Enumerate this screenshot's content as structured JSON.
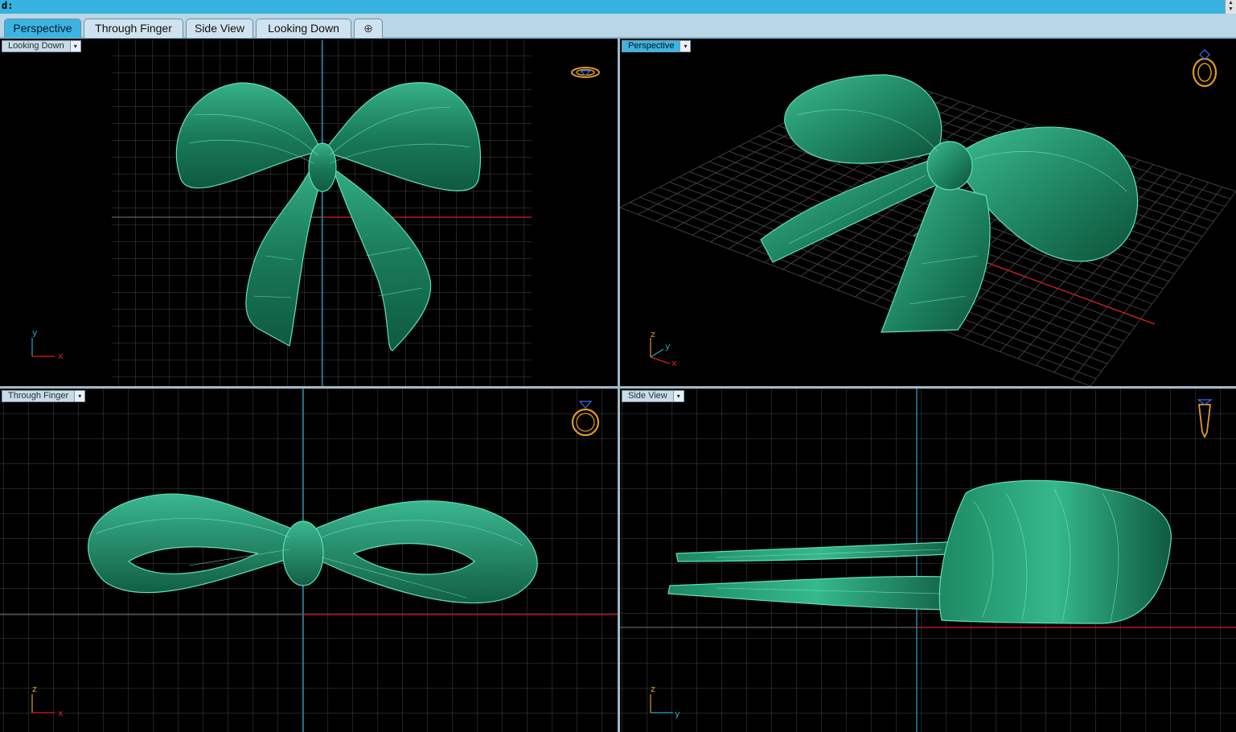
{
  "command_bar": {
    "prompt": "d:"
  },
  "tabs": [
    {
      "label": "Perspective",
      "active": true
    },
    {
      "label": "Through Finger",
      "active": false
    },
    {
      "label": "Side View",
      "active": false
    },
    {
      "label": "Looking Down",
      "active": false
    }
  ],
  "add_tab_icon": "plus-icon",
  "viewports": {
    "top_left": {
      "label": "Looking Down",
      "axes": [
        "y",
        "x"
      ],
      "active": false
    },
    "top_right": {
      "label": "Perspective",
      "axes": [
        "z",
        "y",
        "x"
      ],
      "active": true
    },
    "bottom_left": {
      "label": "Through Finger",
      "axes": [
        "z",
        "x"
      ],
      "active": false
    },
    "bottom_right": {
      "label": "Side View",
      "axes": [
        "z",
        "y"
      ],
      "active": false
    }
  },
  "colors": {
    "command_bar": "#35b2e0",
    "tab_active": "#3cb4e2",
    "tab_inactive": "#cfe3ee",
    "model": "#1f8c66",
    "model_wire": "#5fe0b8",
    "grid": "#4a4a4a",
    "axis_x": "#d61f1f",
    "axis_y": "#2aa8c8",
    "ring_icon": "#e09a20"
  }
}
